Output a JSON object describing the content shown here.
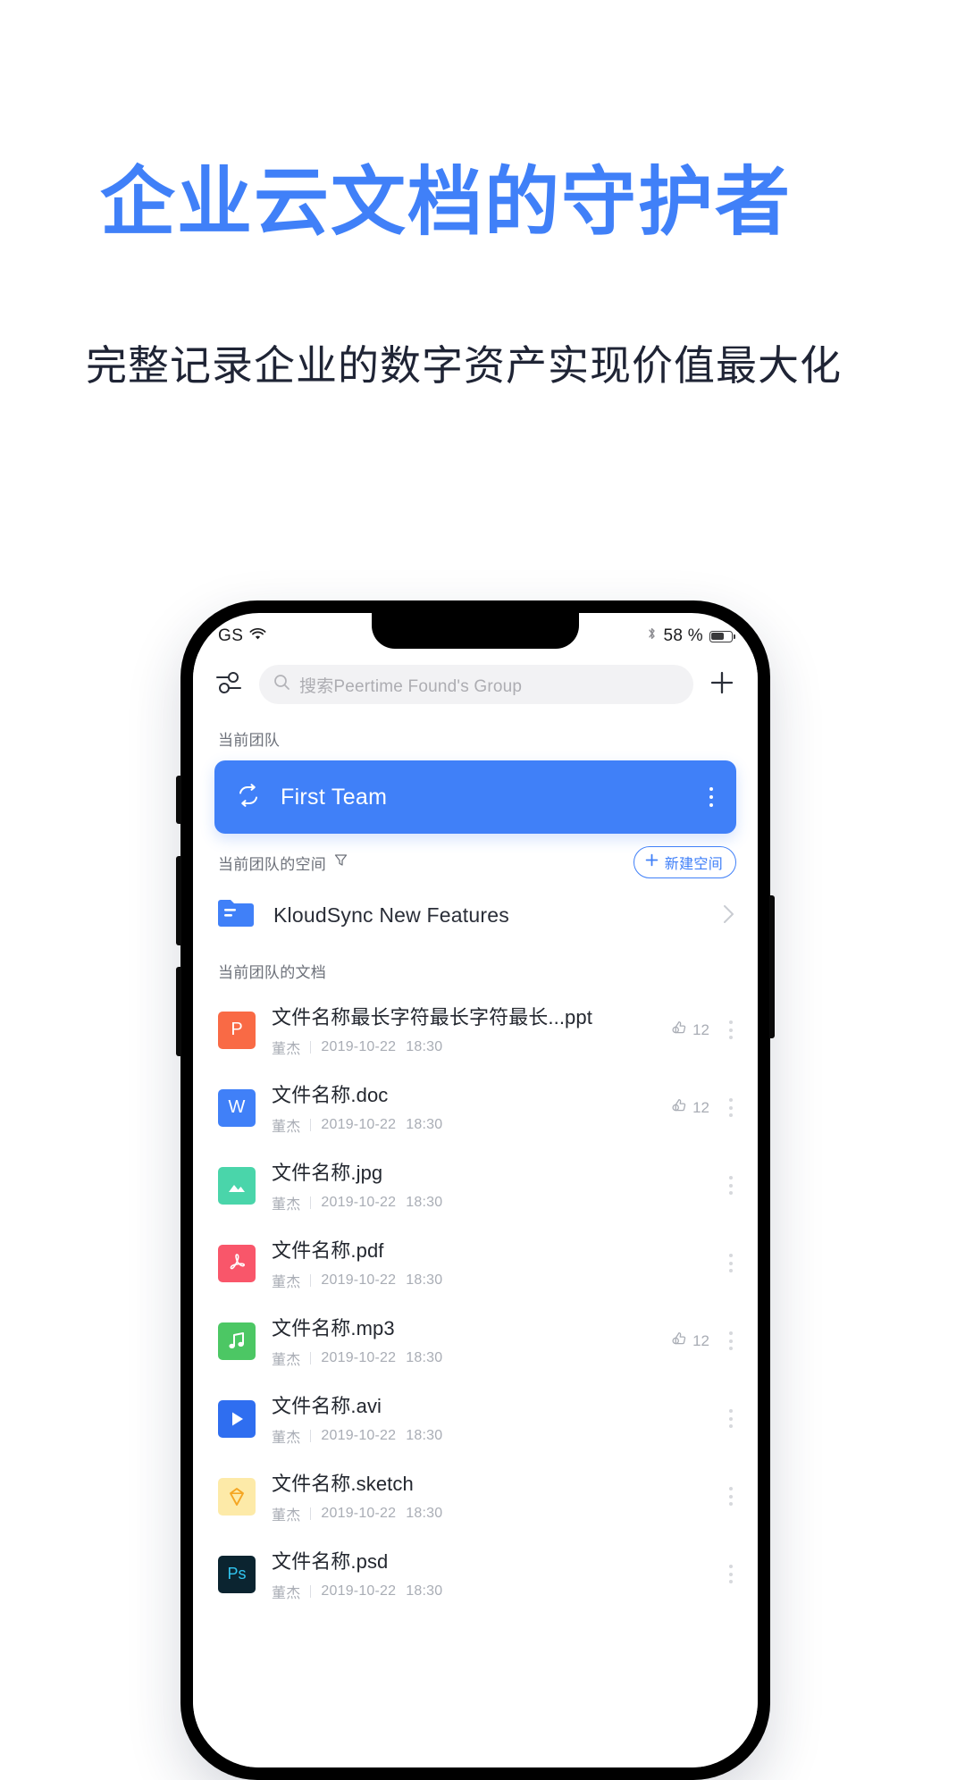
{
  "hero": {
    "title": "企业云文档的守护者",
    "subtitle": "完整记录企业的数字资产实现价值最大化",
    "title_color": "#4080f8",
    "subtitle_color": "#1f2435"
  },
  "status_bar": {
    "carrier": "GS",
    "wifi_icon": "wifi-icon",
    "bluetooth_icon": "bluetooth-icon",
    "battery_percent": "58 %",
    "battery_icon": "battery-icon"
  },
  "toolbar": {
    "filter_icon": "sliders-icon",
    "search_icon": "search-icon",
    "search_placeholder": "搜索Peertime Found's Group",
    "add_icon": "plus-icon"
  },
  "team_section": {
    "label": "当前团队",
    "card": {
      "sync_icon": "sync-icon",
      "name": "First Team",
      "more_icon": "more-vertical-icon",
      "accent": "#4080f8"
    }
  },
  "space_section": {
    "label": "当前团队的空间",
    "filter_icon": "funnel-icon",
    "new_button": {
      "plus_icon": "plus-icon",
      "label": "新建空间"
    },
    "items": [
      {
        "icon": "folder-icon",
        "name": "KloudSync New Features",
        "chevron_icon": "chevron-right-icon",
        "icon_color": "#4080f8"
      }
    ]
  },
  "doc_section": {
    "label": "当前团队的文档",
    "like_icon": "thumbs-up-icon",
    "more_icon": "more-vertical-icon",
    "author": "董杰",
    "files": [
      {
        "name": "文件名称最长字符最长字符最长...ppt",
        "author": "董杰",
        "date": "2019-10-22",
        "time": "18:30",
        "likes": "12",
        "has_likes": true,
        "kind": "ppt",
        "icon": "powerpoint-icon",
        "icon_color": "#f96a45",
        "glyph": "P"
      },
      {
        "name": "文件名称.doc",
        "author": "董杰",
        "date": "2019-10-22",
        "time": "18:30",
        "likes": "12",
        "has_likes": true,
        "kind": "doc",
        "icon": "word-icon",
        "icon_color": "#4080f8",
        "glyph": "W"
      },
      {
        "name": "文件名称.jpg",
        "author": "董杰",
        "date": "2019-10-22",
        "time": "18:30",
        "likes": "",
        "has_likes": false,
        "kind": "jpg",
        "icon": "image-icon",
        "icon_color": "#4ad5aa",
        "glyph": ""
      },
      {
        "name": "文件名称.pdf",
        "author": "董杰",
        "date": "2019-10-22",
        "time": "18:30",
        "likes": "",
        "has_likes": false,
        "kind": "pdf",
        "icon": "pdf-icon",
        "icon_color": "#f9566a",
        "glyph": ""
      },
      {
        "name": "文件名称.mp3",
        "author": "董杰",
        "date": "2019-10-22",
        "time": "18:30",
        "likes": "12",
        "has_likes": true,
        "kind": "mp3",
        "icon": "music-icon",
        "icon_color": "#4cc764",
        "glyph": ""
      },
      {
        "name": "文件名称.avi",
        "author": "董杰",
        "date": "2019-10-22",
        "time": "18:30",
        "likes": "",
        "has_likes": false,
        "kind": "avi",
        "icon": "video-icon",
        "icon_color": "#2f6ef0",
        "glyph": ""
      },
      {
        "name": "文件名称.sketch",
        "author": "董杰",
        "date": "2019-10-22",
        "time": "18:30",
        "likes": "",
        "has_likes": false,
        "kind": "sketch",
        "icon": "sketch-icon",
        "icon_color": "#fdeaa8",
        "glyph": ""
      },
      {
        "name": "文件名称.psd",
        "author": "董杰",
        "date": "2019-10-22",
        "time": "18:30",
        "likes": "",
        "has_likes": false,
        "kind": "psd",
        "icon": "photoshop-icon",
        "icon_color": "#0b2430",
        "glyph": "Ps"
      }
    ]
  }
}
